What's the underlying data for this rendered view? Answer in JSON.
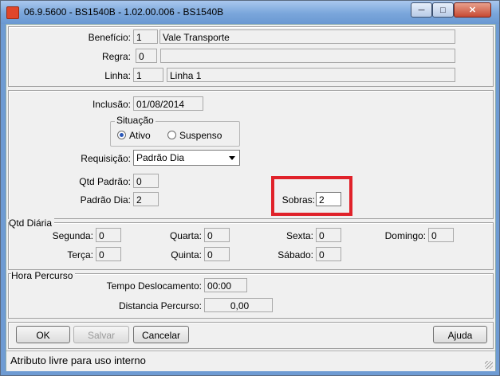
{
  "window": {
    "title": "06.9.5600 - BS1540B - 1.02.00.006 - BS1540B"
  },
  "header": {
    "beneficio_label": "Benefício:",
    "beneficio_code": "1",
    "beneficio_name": "Vale Transporte",
    "regra_label": "Regra:",
    "regra_code": "0",
    "regra_name": "",
    "linha_label": "Linha:",
    "linha_code": "1",
    "linha_name": "Linha 1"
  },
  "details": {
    "inclusao_label": "Inclusão:",
    "inclusao_value": "01/08/2014",
    "situacao_title": "Situação",
    "ativo_label": "Ativo",
    "suspenso_label": "Suspenso",
    "situacao_selected": "Ativo",
    "requisicao_label": "Requisição:",
    "requisicao_value": "Padrão Dia",
    "qtd_padrao_label": "Qtd Padrão:",
    "qtd_padrao_value": "0",
    "padrao_dia_label": "Padrão Dia:",
    "padrao_dia_value": "2",
    "sobras_label": "Sobras:",
    "sobras_value": "2"
  },
  "qtd_diaria": {
    "title": "Qtd Diária",
    "days": [
      {
        "label": "Segunda:",
        "value": "0"
      },
      {
        "label": "Quarta:",
        "value": "0"
      },
      {
        "label": "Sexta:",
        "value": "0"
      },
      {
        "label": "Domingo:",
        "value": "0"
      },
      {
        "label": "Terça:",
        "value": "0"
      },
      {
        "label": "Quinta:",
        "value": "0"
      },
      {
        "label": "Sábado:",
        "value": "0"
      }
    ]
  },
  "hora_percurso": {
    "title": "Hora Percurso",
    "tempo_label": "Tempo Deslocamento:",
    "tempo_value": "00:00",
    "distancia_label": "Distancia  Percurso:",
    "distancia_value": "0,00"
  },
  "buttons": {
    "ok": "OK",
    "salvar": "Salvar",
    "cancelar": "Cancelar",
    "ajuda": "Ajuda"
  },
  "status": {
    "text": "Atributo livre para uso interno"
  },
  "colors": {
    "highlight": "#e0222a",
    "titlebar": "#7aa6db"
  }
}
